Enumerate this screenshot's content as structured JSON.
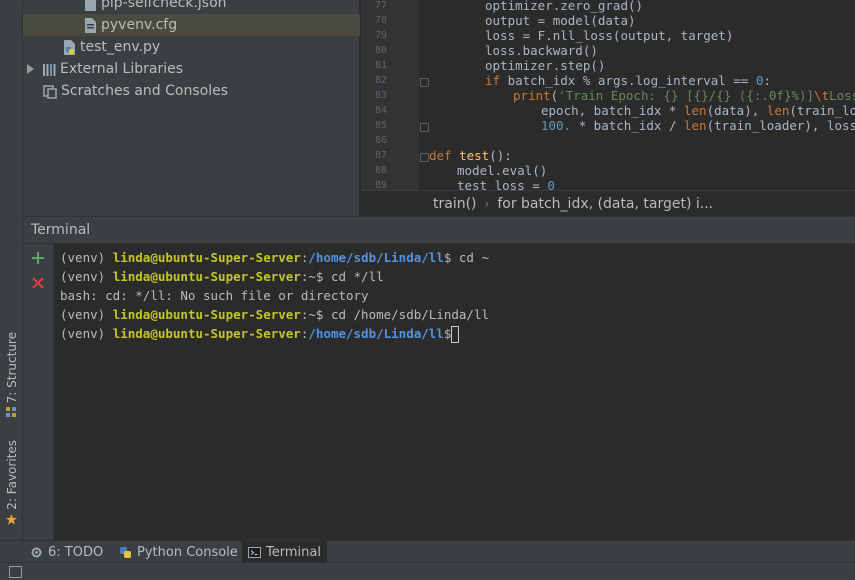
{
  "left_strip": {
    "structure_label": "7: Structure",
    "favorites_label": "2: Favorites"
  },
  "project_tree": {
    "items": [
      {
        "label": "pip-selfcheck.json",
        "icon": "json-file-icon"
      },
      {
        "label": "pyvenv.cfg",
        "icon": "config-file-icon"
      },
      {
        "label": "test_env.py",
        "icon": "python-file-icon"
      },
      {
        "label": "External Libraries",
        "icon": "library-icon"
      },
      {
        "label": "Scratches and Consoles",
        "icon": "scratches-icon"
      }
    ]
  },
  "editor": {
    "line_numbers": [
      "77",
      "78",
      "79",
      "80",
      "81",
      "82",
      "83",
      "84",
      "85",
      "86",
      "87",
      "88",
      "89"
    ],
    "breadcrumb": [
      "train()",
      "for batch_idx, (data, target) i..."
    ]
  },
  "terminal": {
    "title": "Terminal",
    "lines": [
      {
        "prefix": "(venv) ",
        "user": "linda@ubuntu-Super-Server",
        "colon": ":",
        "path": "/home/sdb/Linda/ll",
        "rest": "$ cd ~"
      },
      {
        "prefix": "(venv) ",
        "user": "linda@ubuntu-Super-Server",
        "colon": ":",
        "path": "",
        "rest": "~$ cd */ll"
      },
      {
        "plain": "bash: cd: */ll: No such file or directory"
      },
      {
        "prefix": "(venv) ",
        "user": "linda@ubuntu-Super-Server",
        "colon": ":",
        "path": "",
        "rest": "~$ cd /home/sdb/Linda/ll"
      },
      {
        "prefix": "(venv) ",
        "user": "linda@ubuntu-Super-Server",
        "colon": ":",
        "path": "/home/sdb/Linda/ll",
        "rest": "$"
      }
    ]
  },
  "bottom_tabs": [
    {
      "label": "6: TODO",
      "icon": "todo-icon"
    },
    {
      "label": "Python Console",
      "icon": "python-console-icon"
    },
    {
      "label": "Terminal",
      "icon": "terminal-icon"
    }
  ]
}
